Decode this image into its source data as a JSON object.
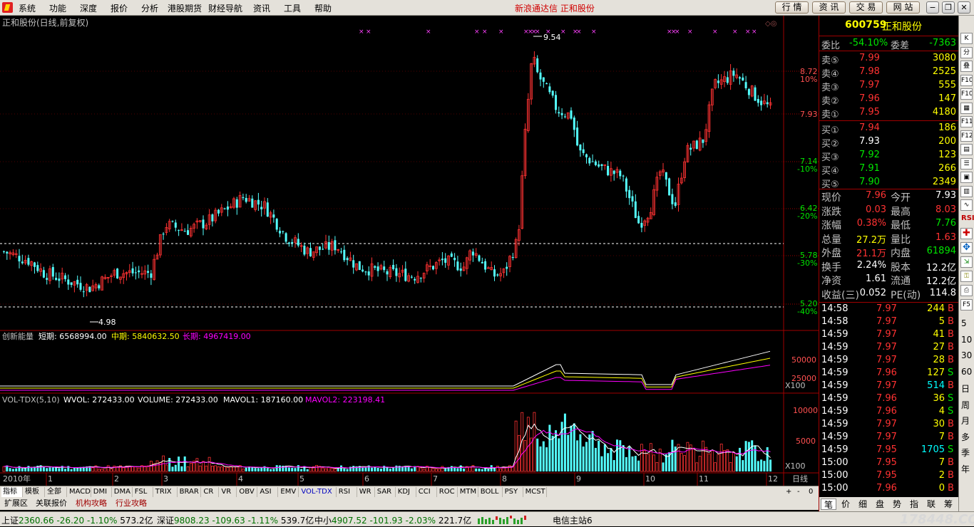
{
  "menu": [
    "系统",
    "功能",
    "深度",
    "报价",
    "分析",
    "港股期货",
    "财经导航",
    "资讯",
    "工具",
    "帮助"
  ],
  "brand_title": "新浪通达信  正和股份",
  "top_buttons": [
    "行 情",
    "资 讯",
    "交 易",
    "网 站"
  ],
  "chart_header": "正和股份(日线,前复权)",
  "price_axis": {
    "labels": [
      "8.72",
      "10%",
      "7.93",
      "7.14",
      "-10%",
      "6.42",
      "-20%",
      "5.78",
      "-30%",
      "5.20",
      "-40%"
    ]
  },
  "annotations": {
    "high": "9.54",
    "low": "4.98"
  },
  "x_axis": {
    "year": "2010年",
    "months": [
      "1",
      "2",
      "3",
      "4",
      "5",
      "6",
      "7",
      "8",
      "9",
      "10",
      "11",
      "12"
    ]
  },
  "indicator1": {
    "name": "创新能量",
    "short_label": "短期: 6568994.00",
    "mid_label": "中期: 5840632.50",
    "long_label": "长期: 4967419.00",
    "axis": [
      "50000",
      "25000",
      "X100"
    ]
  },
  "indicator2": {
    "name": "VOL-TDX(5,10)",
    "wvol": "WVOL: 272433.00",
    "volume": "VOLUME: 272433.00",
    "mavol1": "MAVOL1: 187160.00",
    "mavol2": "MAVOL2: 223198.41",
    "axis": [
      "10000",
      "5000",
      "X100"
    ]
  },
  "period_label": "日线",
  "tabs": [
    "指标",
    "模板",
    "全部",
    "MACD",
    "DMI",
    "DMA",
    "FSL",
    "TRIX",
    "BRAR",
    "CR",
    "VR",
    "OBV",
    "ASI",
    "EMV",
    "VOL-TDX",
    "RSI",
    "WR",
    "SAR",
    "KDJ",
    "CCI",
    "ROC",
    "MTM",
    "BOLL",
    "PSY",
    "MCST"
  ],
  "tabs_right": [
    "+",
    "-",
    "0"
  ],
  "tabs2": [
    "扩展区",
    "关联报价",
    "机构攻略",
    "行业攻略"
  ],
  "quote": {
    "code": "600759",
    "name": "正和股份",
    "weibi_label": "委比",
    "weibi": "-54.10%",
    "weicha_label": "委差",
    "weicha": "-7363",
    "sell": [
      {
        "label": "卖⑤",
        "price": "7.99",
        "vol": "3080"
      },
      {
        "label": "卖④",
        "price": "7.98",
        "vol": "2525"
      },
      {
        "label": "卖③",
        "price": "7.97",
        "vol": "555"
      },
      {
        "label": "卖②",
        "price": "7.96",
        "vol": "147"
      },
      {
        "label": "卖①",
        "price": "7.95",
        "vol": "4180"
      }
    ],
    "buy": [
      {
        "label": "买①",
        "price": "7.94",
        "vol": "186"
      },
      {
        "label": "买②",
        "price": "7.93",
        "vol": "200"
      },
      {
        "label": "买③",
        "price": "7.92",
        "vol": "123"
      },
      {
        "label": "买④",
        "price": "7.91",
        "vol": "266"
      },
      {
        "label": "买⑤",
        "price": "7.90",
        "vol": "2349"
      }
    ],
    "stats": [
      {
        "l1": "现价",
        "v1": "7.96",
        "l2": "今开",
        "v2": "7.93"
      },
      {
        "l1": "涨跌",
        "v1": "0.03",
        "l2": "最高",
        "v2": "8.03"
      },
      {
        "l1": "涨幅",
        "v1": "0.38%",
        "l2": "最低",
        "v2": "7.76"
      },
      {
        "l1": "总量",
        "v1": "27.2万",
        "l2": "量比",
        "v2": "1.63"
      },
      {
        "l1": "外盘",
        "v1": "21.1万",
        "l2": "内盘",
        "v2": "61894"
      },
      {
        "l1": "换手",
        "v1": "2.24%",
        "l2": "股本",
        "v2": "12.2亿"
      },
      {
        "l1": "净资",
        "v1": "1.61",
        "l2": "流通",
        "v2": "12.2亿"
      },
      {
        "l1": "收益(三)",
        "v1": "0.052",
        "l2": "PE(动)",
        "v2": "114.8"
      }
    ]
  },
  "ticks": [
    {
      "t": "14:58",
      "p": "7.97",
      "v": "244",
      "s": "B"
    },
    {
      "t": "14:58",
      "p": "7.97",
      "v": "5",
      "s": "B"
    },
    {
      "t": "14:59",
      "p": "7.97",
      "v": "41",
      "s": "B"
    },
    {
      "t": "14:59",
      "p": "7.97",
      "v": "27",
      "s": "B"
    },
    {
      "t": "14:59",
      "p": "7.97",
      "v": "28",
      "s": "B"
    },
    {
      "t": "14:59",
      "p": "7.96",
      "v": "127",
      "s": "S"
    },
    {
      "t": "14:59",
      "p": "7.97",
      "v": "514",
      "s": "B"
    },
    {
      "t": "14:59",
      "p": "7.96",
      "v": "36",
      "s": "S"
    },
    {
      "t": "14:59",
      "p": "7.96",
      "v": "4",
      "s": "S"
    },
    {
      "t": "14:59",
      "p": "7.97",
      "v": "30",
      "s": "B"
    },
    {
      "t": "14:59",
      "p": "7.97",
      "v": "7",
      "s": "B"
    },
    {
      "t": "14:59",
      "p": "7.95",
      "v": "1705",
      "s": "S"
    },
    {
      "t": "15:00",
      "p": "7.95",
      "v": "7",
      "s": "B"
    },
    {
      "t": "15:00",
      "p": "7.95",
      "v": "2",
      "s": "B"
    },
    {
      "t": "15:00",
      "p": "7.96",
      "v": "0",
      "s": "B"
    }
  ],
  "right_tabs": [
    "笔",
    "价",
    "细",
    "盘",
    "势",
    "指",
    "联",
    "筹"
  ],
  "right_icons": [
    "RSI",
    "F5",
    "5",
    "10",
    "30",
    "60",
    "日",
    "周",
    "月",
    "多",
    "季",
    "年"
  ],
  "status": {
    "sh": {
      "name": "上证",
      "val": "2360.66",
      "chg": "-26.20",
      "pct": "-1.10%",
      "amt": "573.2亿"
    },
    "sz": {
      "name": "深证",
      "val": "9808.23",
      "chg": "-109.63",
      "pct": "-1.11%",
      "amt": "539.7亿"
    },
    "zx": {
      "name": "中小",
      "val": "4907.52",
      "chg": "-101.93",
      "pct": "-2.03%",
      "amt": "221.7亿"
    },
    "server": "电信主站6",
    "watermark": "178448.COM"
  },
  "colors": {
    "up": "#ff3232",
    "down": "#54ffff",
    "bg": "#000000",
    "grid": "#a00000",
    "short": "#ffffff",
    "mid": "#ffff00",
    "long": "#ff00ff"
  }
}
